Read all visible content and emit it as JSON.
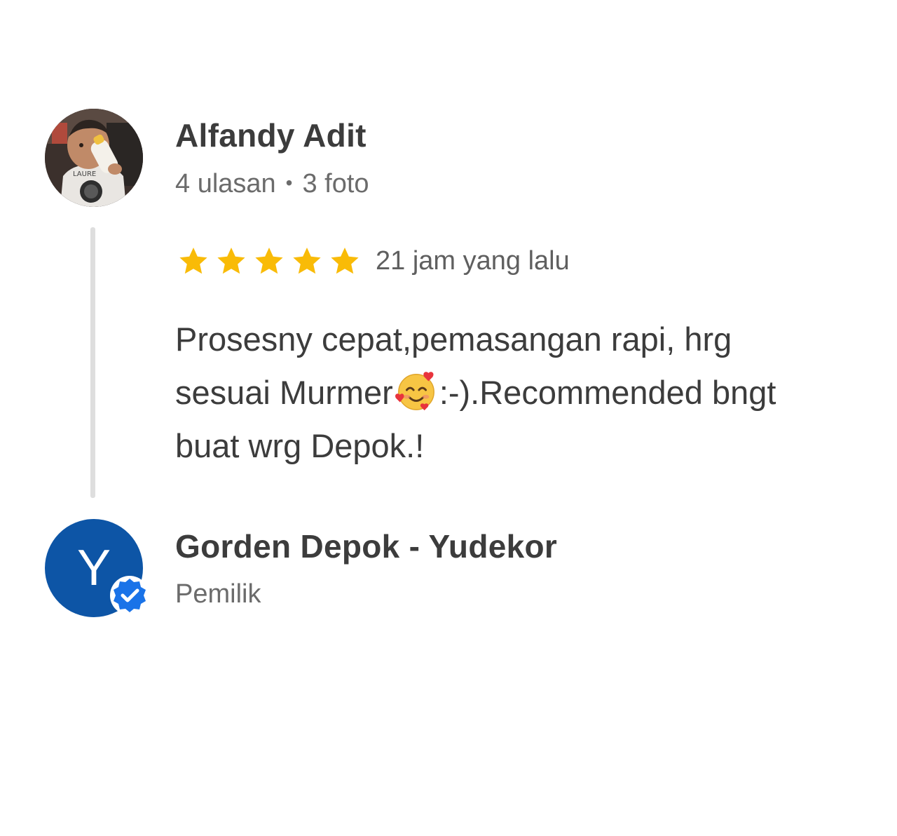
{
  "review": {
    "reviewer_name": "Alfandy Adit",
    "review_count": "4 ulasan",
    "separator": "•",
    "photo_count": "3 foto",
    "rating": 5,
    "rating_max": 5,
    "time_ago": "21 jam yang lalu",
    "text_lines": {
      "l1": "Prosesny cepat,pemasangan rapi, hrg",
      "l2a": "sesuai Murmer",
      "emoji": "smiling-face-with-hearts",
      "l2b": ":-).Recommended bngt",
      "l3": "buat wrg Depok.!"
    }
  },
  "reply": {
    "owner_initial": "Y",
    "owner_name": "Gorden Depok - Yudekor",
    "owner_role": "Pemilik"
  },
  "colors": {
    "star": "#f9bb07",
    "owner_avatar": "#0d55a6",
    "verified_badge": "#1a73e8",
    "thread_line": "#dedede"
  }
}
